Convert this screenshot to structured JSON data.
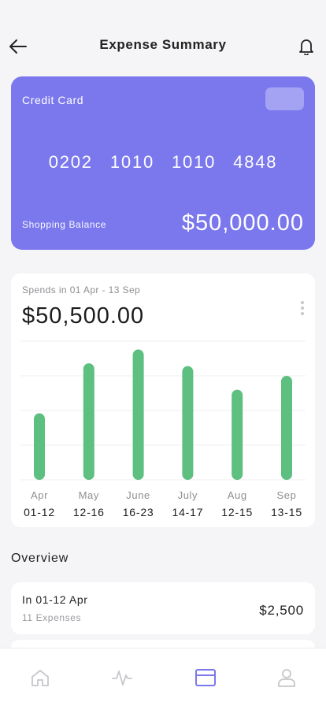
{
  "header": {
    "title": "Expense Summary",
    "back_icon": "arrow-left-icon",
    "bell_icon": "bell-icon"
  },
  "card": {
    "label": "Credit Card",
    "number_groups": [
      "0202",
      "1010",
      "1010",
      "4848"
    ],
    "balance_label": "Shopping Balance",
    "balance_value": "$50,000.00",
    "color": "#7a78ec"
  },
  "spends": {
    "range_label": "Spends in 01 Apr - 13 Sep",
    "total": "$50,500.00"
  },
  "chart_data": {
    "type": "bar",
    "categories": [
      "Apr",
      "May",
      "June",
      "July",
      "Aug",
      "Sep"
    ],
    "ranges": [
      "01-12",
      "12-16",
      "16-23",
      "14-17",
      "12-15",
      "13-15"
    ],
    "values": [
      48,
      84,
      94,
      82,
      65,
      75
    ],
    "ylim": [
      0,
      100
    ],
    "grid": true,
    "bar_color": "#5dbf80"
  },
  "overview": {
    "title": "Overview",
    "items": [
      {
        "period": "In 01-12 Apr",
        "count": "11 Expenses",
        "amount": "$2,500"
      }
    ]
  },
  "tabbar": {
    "active": "card",
    "active_color": "#7a78ec",
    "tabs": [
      {
        "name": "home",
        "icon": "home-icon"
      },
      {
        "name": "activity",
        "icon": "activity-icon"
      },
      {
        "name": "card",
        "icon": "card-icon"
      },
      {
        "name": "profile",
        "icon": "user-icon"
      }
    ]
  }
}
